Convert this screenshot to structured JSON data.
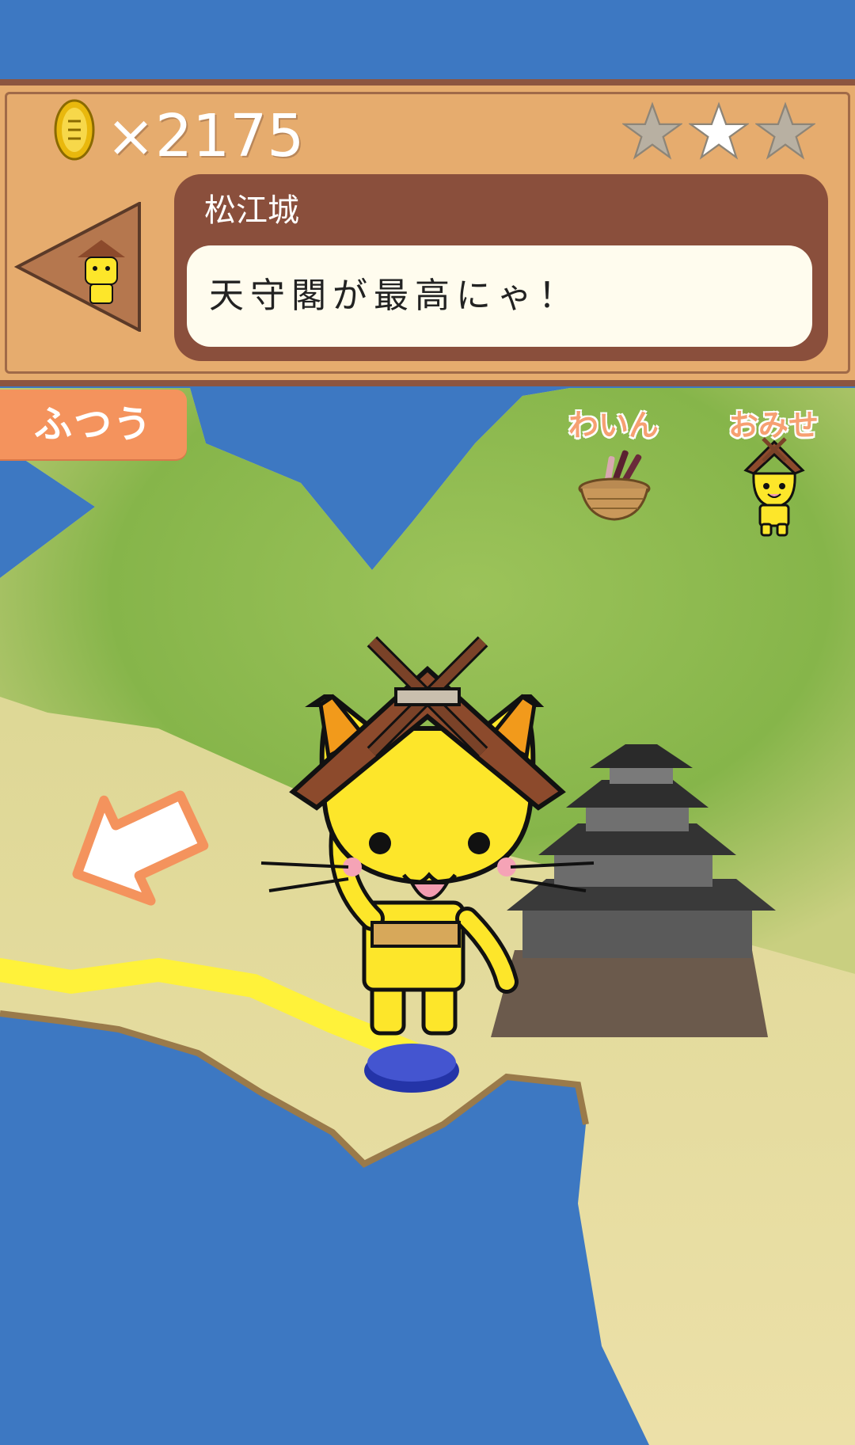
{
  "hud": {
    "coin_icon": "gold-koban-coin-icon",
    "coin_count": "×2175",
    "stars": [
      {
        "state": "empty",
        "color": "#b8b0a2"
      },
      {
        "state": "filled",
        "color": "#ffffff"
      },
      {
        "state": "empty",
        "color": "#b8b0a2"
      }
    ]
  },
  "dialog": {
    "speaker": "松江城",
    "message": "天守閣が最高にゃ！"
  },
  "mode": {
    "label": "ふつう"
  },
  "menu": {
    "wine_label": "わいん",
    "wine_icon": "wine-basket-icon",
    "shop_label": "おみせ",
    "shop_icon": "shimanekko-shop-icon"
  },
  "map": {
    "back_arrow_icon": "back-arrow-icon",
    "character": "shimanekko-mascot",
    "landmark": "matsue-castle",
    "stage_marker": "blue-stage-button",
    "colors": {
      "sea": "#3d78c2",
      "grass": "#86b54a",
      "sand": "#e9dca1",
      "path": "#fff23a",
      "panel": "#e6ac6e",
      "dialog": "#8a4f3c",
      "accent": "#f4935d"
    }
  }
}
